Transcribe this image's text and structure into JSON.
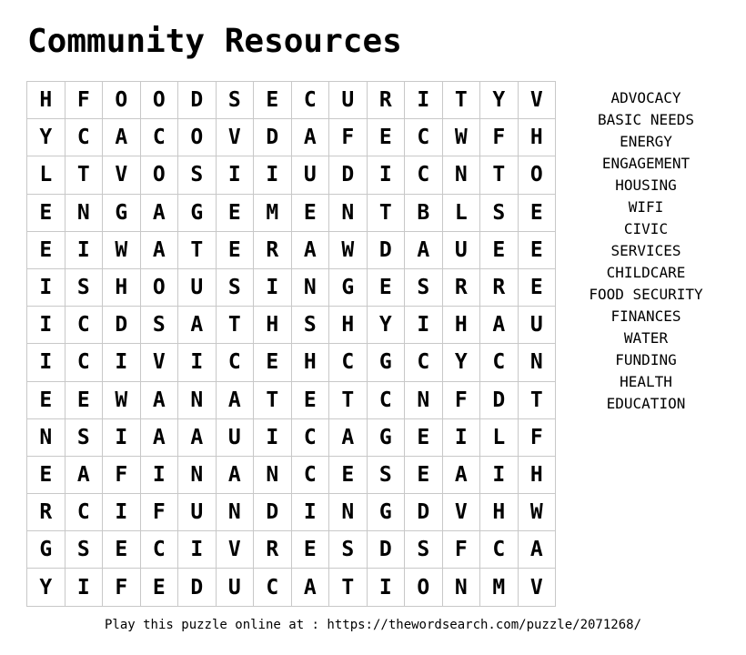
{
  "title": "Community Resources",
  "grid": [
    [
      "H",
      "F",
      "O",
      "O",
      "D",
      "S",
      "E",
      "C",
      "U",
      "R",
      "I",
      "T",
      "Y",
      "V"
    ],
    [
      "Y",
      "C",
      "A",
      "C",
      "O",
      "V",
      "D",
      "A",
      "F",
      "E",
      "C",
      "W",
      "F",
      "H"
    ],
    [
      "L",
      "T",
      "V",
      "O",
      "S",
      "I",
      "I",
      "U",
      "D",
      "I",
      "C",
      "N",
      "T",
      "O"
    ],
    [
      "E",
      "N",
      "G",
      "A",
      "G",
      "E",
      "M",
      "E",
      "N",
      "T",
      "B",
      "L",
      "S",
      "E"
    ],
    [
      "E",
      "I",
      "W",
      "A",
      "T",
      "E",
      "R",
      "A",
      "W",
      "D",
      "A",
      "U",
      "E",
      "E"
    ],
    [
      "I",
      "S",
      "H",
      "O",
      "U",
      "S",
      "I",
      "N",
      "G",
      "E",
      "S",
      "R",
      "R",
      "E"
    ],
    [
      "I",
      "C",
      "D",
      "S",
      "A",
      "T",
      "H",
      "S",
      "H",
      "Y",
      "I",
      "H",
      "A",
      "U"
    ],
    [
      "I",
      "C",
      "I",
      "V",
      "I",
      "C",
      "E",
      "H",
      "C",
      "G",
      "C",
      "Y",
      "C",
      "N"
    ],
    [
      "E",
      "E",
      "W",
      "A",
      "N",
      "A",
      "T",
      "E",
      "T",
      "C",
      "N",
      "F",
      "D",
      "T"
    ],
    [
      "N",
      "S",
      "I",
      "A",
      "A",
      "U",
      "I",
      "C",
      "A",
      "G",
      "E",
      "I",
      "L",
      "F"
    ],
    [
      "E",
      "A",
      "F",
      "I",
      "N",
      "A",
      "N",
      "C",
      "E",
      "S",
      "E",
      "A",
      "I",
      "H"
    ],
    [
      "R",
      "C",
      "I",
      "F",
      "U",
      "N",
      "D",
      "I",
      "N",
      "G",
      "D",
      "V",
      "H",
      "W"
    ],
    [
      "G",
      "S",
      "E",
      "C",
      "I",
      "V",
      "R",
      "E",
      "S",
      "D",
      "S",
      "F",
      "C",
      "A"
    ],
    [
      "Y",
      "I",
      "F",
      "E",
      "D",
      "U",
      "C",
      "A",
      "T",
      "I",
      "O",
      "N",
      "M",
      "V"
    ]
  ],
  "words": [
    "ADVOCACY",
    "BASIC NEEDS",
    "ENERGY",
    "ENGAGEMENT",
    "HOUSING",
    "WIFI",
    "CIVIC",
    "SERVICES",
    "CHILDCARE",
    "FOOD SECURITY",
    "FINANCES",
    "WATER",
    "FUNDING",
    "HEALTH",
    "EDUCATION"
  ],
  "footer": "Play this puzzle online at : https://thewordsearch.com/puzzle/2071268/"
}
